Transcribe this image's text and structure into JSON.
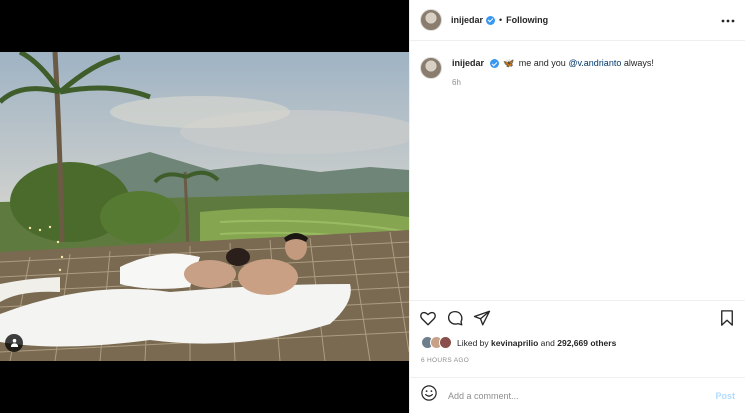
{
  "post": {
    "author": "inijedar",
    "follow_separator": "•",
    "follow_status": "Following",
    "more_icon": "more-options-icon",
    "caption_text": "me and you",
    "caption_emoji": "🦋",
    "caption_mention": "@v.andrianto",
    "caption_tail": "always!",
    "time_ago": "6h",
    "liked_prefix": "Liked by",
    "liked_user": "kevinaprilio",
    "liked_and": "and",
    "liked_count": "292,669 others",
    "posted_date": "6 HOURS AGO"
  },
  "actions": {
    "like": "heart-icon",
    "comment": "comment-icon",
    "share": "share-icon",
    "save": "bookmark-icon"
  },
  "comment_box": {
    "placeholder": "Add a comment...",
    "post_label": "Post"
  },
  "colors": {
    "link": "#00376b",
    "verified": "#3897f0",
    "muted": "#8e8e8e",
    "post_button_disabled": "#b3dbff"
  }
}
